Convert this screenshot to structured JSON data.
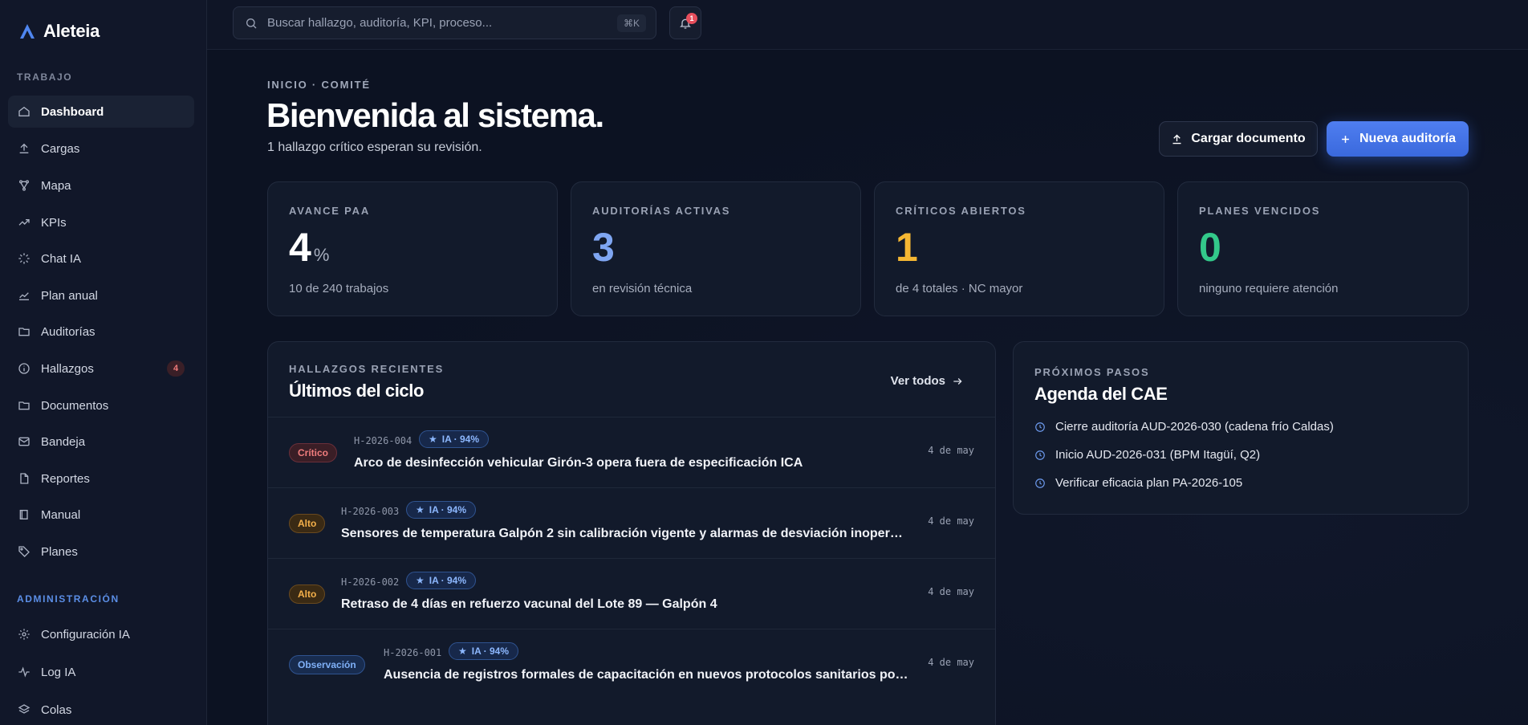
{
  "brand": {
    "name": "Aleteia"
  },
  "sidebar": {
    "sections": [
      {
        "label": "TRABAJO"
      },
      {
        "label": "ADMINISTRACIÓN"
      }
    ],
    "items": [
      {
        "label": "Dashboard",
        "icon": "home-icon",
        "active": true
      },
      {
        "label": "Cargas",
        "icon": "upload-icon"
      },
      {
        "label": "Mapa",
        "icon": "network-icon"
      },
      {
        "label": "KPIs",
        "icon": "trend-up-icon"
      },
      {
        "label": "Chat IA",
        "icon": "sparkle-loader-icon"
      },
      {
        "label": "Plan anual",
        "icon": "line-chart-icon"
      },
      {
        "label": "Auditorías",
        "icon": "folder-icon"
      },
      {
        "label": "Hallazgos",
        "icon": "info-circle-icon",
        "badge": "4"
      },
      {
        "label": "Documentos",
        "icon": "folder-icon"
      },
      {
        "label": "Bandeja",
        "icon": "mail-icon"
      },
      {
        "label": "Reportes",
        "icon": "file-icon"
      },
      {
        "label": "Manual",
        "icon": "book-icon"
      },
      {
        "label": "Planes",
        "icon": "tag-icon"
      }
    ],
    "admin_items": [
      {
        "label": "Configuración IA",
        "icon": "gear-icon"
      },
      {
        "label": "Log IA",
        "icon": "pulse-icon"
      },
      {
        "label": "Colas",
        "icon": "layers-icon"
      }
    ]
  },
  "topbar": {
    "search_placeholder": "Buscar hallazgo, auditoría, KPI, proceso...",
    "search_shortcut": "⌘K",
    "notifications_count": "1"
  },
  "header": {
    "breadcrumb": "INICIO · COMITÉ",
    "title": "Bienvenida al sistema.",
    "subtitle": "1 hallazgo crítico esperan su revisión.",
    "upload_label": "Cargar documento",
    "new_audit_label": "Nueva auditoría"
  },
  "kpis": [
    {
      "label": "AVANCE PAA",
      "value": "4",
      "unit": "%",
      "sub": "10 de 240 trabajos",
      "color": "#ffffff"
    },
    {
      "label": "AUDITORÍAS ACTIVAS",
      "value": "3",
      "unit": "",
      "sub": "en revisión técnica",
      "color": "#7fa6f2"
    },
    {
      "label": "CRÍTICOS ABIERTOS",
      "value": "1",
      "unit": "",
      "sub": "de 4 totales · NC mayor",
      "color": "#f5b733"
    },
    {
      "label": "PLANES VENCIDOS",
      "value": "0",
      "unit": "",
      "sub": "ninguno requiere atención",
      "color": "#33c98a"
    }
  ],
  "findings": {
    "section_label": "HALLAZGOS RECIENTES",
    "title": "Últimos del ciclo",
    "view_all": "Ver todos",
    "rows": [
      {
        "severity": "Crítico",
        "sev_class": "critico",
        "code": "H-2026-004",
        "ai": "IA · 94%",
        "title": "Arco de desinfección vehicular Girón-3 opera fuera de especificación ICA",
        "date": "4 de may"
      },
      {
        "severity": "Alto",
        "sev_class": "alto",
        "code": "H-2026-003",
        "ai": "IA · 94%",
        "title": "Sensores de temperatura Galpón 2 sin calibración vigente y alarmas de desviación inoperantes",
        "date": "4 de may"
      },
      {
        "severity": "Alto",
        "sev_class": "alto",
        "code": "H-2026-002",
        "ai": "IA · 94%",
        "title": "Retraso de 4 días en refuerzo vacunal del Lote 89 — Galpón 4",
        "date": "4 de may"
      },
      {
        "severity": "Observación",
        "sev_class": "obs",
        "code": "H-2026-001",
        "ai": "IA · 94%",
        "title": "Ausencia de registros formales de capacitación en nuevos protocolos sanitarios post-br...",
        "date": "4 de may"
      }
    ]
  },
  "agenda": {
    "section_label": "PRÓXIMOS PASOS",
    "title": "Agenda del CAE",
    "items": [
      "Cierre auditoría AUD-2026-030 (cadena frío Caldas)",
      "Inicio AUD-2026-031 (BPM Itagüí, Q2)",
      "Verificar eficacia plan PA-2026-105"
    ]
  }
}
